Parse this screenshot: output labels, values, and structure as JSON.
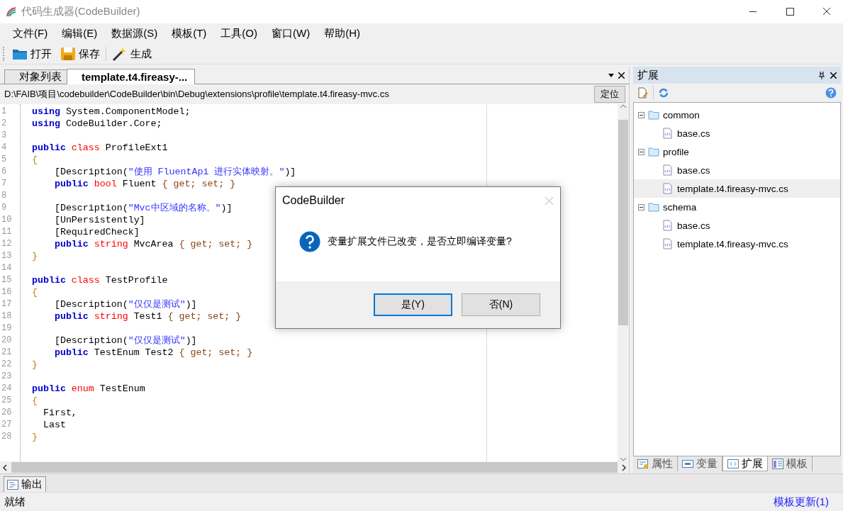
{
  "window": {
    "title": "代码生成器(CodeBuilder)"
  },
  "menu": [
    "文件(F)",
    "编辑(E)",
    "数据源(S)",
    "模板(T)",
    "工具(O)",
    "窗口(W)",
    "帮助(H)"
  ],
  "toolbar": [
    {
      "kind": "open",
      "label": "打开"
    },
    {
      "kind": "save",
      "label": "保存"
    },
    {
      "kind": "generate",
      "label": "生成"
    }
  ],
  "document_tabs": [
    {
      "label": "对象列表",
      "selected": false
    },
    {
      "label": "template.t4.fireasy-...",
      "selected": true
    }
  ],
  "path_bar": {
    "path": "D:\\FAIB\\项目\\codebuilder\\CodeBuilder\\bin\\Debug\\extensions\\profile\\template.t4.fireasy-mvc.cs",
    "button": "定位"
  },
  "code_lines": [
    {
      "n": "1",
      "segs": [
        {
          "kind": "kw",
          "text": "using"
        },
        {
          "kind": "plain",
          "text": " System.ComponentModel;"
        }
      ]
    },
    {
      "n": "2",
      "segs": [
        {
          "kind": "kw",
          "text": "using"
        },
        {
          "kind": "plain",
          "text": " CodeBuilder.Core;"
        }
      ]
    },
    {
      "n": "3"
    },
    {
      "n": "4",
      "segs": [
        {
          "kind": "kw",
          "text": "public"
        },
        {
          "kind": "type",
          "text": " class"
        },
        {
          "kind": "plain",
          "text": " ProfileExt1"
        }
      ]
    },
    {
      "n": "5",
      "segs": [
        {
          "kind": "brace",
          "text": "{"
        }
      ]
    },
    {
      "n": "6",
      "segs": [
        {
          "kind": "plain",
          "text": "    [Description("
        },
        {
          "kind": "str",
          "text": "\"使用 FluentApi 进行实体映射。\""
        },
        {
          "kind": "plain",
          "text": ")]"
        }
      ]
    },
    {
      "n": "7",
      "segs": [
        {
          "kind": "kw",
          "text": "    public"
        },
        {
          "kind": "type",
          "text": " bool"
        },
        {
          "kind": "plain",
          "text": " Fluent "
        },
        {
          "kind": "acc",
          "text": "{ get; set; }"
        }
      ]
    },
    {
      "n": "8"
    },
    {
      "n": "9",
      "segs": [
        {
          "kind": "plain",
          "text": "    [Description("
        },
        {
          "kind": "str",
          "text": "\"Mvc中区域的名称。\""
        },
        {
          "kind": "plain",
          "text": ")]"
        }
      ]
    },
    {
      "n": "10",
      "segs": [
        {
          "kind": "plain",
          "text": "    [UnPersistently]"
        }
      ]
    },
    {
      "n": "11",
      "segs": [
        {
          "kind": "plain",
          "text": "    [RequiredCheck]"
        }
      ]
    },
    {
      "n": "12",
      "segs": [
        {
          "kind": "kw",
          "text": "    public"
        },
        {
          "kind": "type",
          "text": " string"
        },
        {
          "kind": "plain",
          "text": " MvcArea "
        },
        {
          "kind": "acc",
          "text": "{ get; set; }"
        }
      ]
    },
    {
      "n": "13",
      "segs": [
        {
          "kind": "brace",
          "text": "}"
        }
      ]
    },
    {
      "n": "14"
    },
    {
      "n": "15",
      "segs": [
        {
          "kind": "kw",
          "text": "public"
        },
        {
          "kind": "type",
          "text": " class"
        },
        {
          "kind": "plain",
          "text": " TestProfile"
        }
      ]
    },
    {
      "n": "16",
      "segs": [
        {
          "kind": "brace",
          "text": "{"
        }
      ]
    },
    {
      "n": "17",
      "segs": [
        {
          "kind": "plain",
          "text": "    [Description("
        },
        {
          "kind": "str",
          "text": "\"仅仅是测试\""
        },
        {
          "kind": "plain",
          "text": ")]"
        }
      ]
    },
    {
      "n": "18",
      "segs": [
        {
          "kind": "kw",
          "text": "    public"
        },
        {
          "kind": "type",
          "text": " string"
        },
        {
          "kind": "plain",
          "text": " Test1 "
        },
        {
          "kind": "acc",
          "text": "{ get; set; }"
        }
      ]
    },
    {
      "n": "19"
    },
    {
      "n": "20",
      "segs": [
        {
          "kind": "plain",
          "text": "    [Description("
        },
        {
          "kind": "str",
          "text": "\"仅仅是测试\""
        },
        {
          "kind": "plain",
          "text": ")]"
        }
      ]
    },
    {
      "n": "21",
      "segs": [
        {
          "kind": "kw",
          "text": "    public"
        },
        {
          "kind": "plain",
          "text": " TestEnum Test2 "
        },
        {
          "kind": "acc",
          "text": "{ get; set; }"
        }
      ]
    },
    {
      "n": "22",
      "segs": [
        {
          "kind": "brace",
          "text": "}"
        }
      ]
    },
    {
      "n": "23"
    },
    {
      "n": "24",
      "segs": [
        {
          "kind": "kw",
          "text": "public"
        },
        {
          "kind": "type",
          "text": " enum"
        },
        {
          "kind": "plain",
          "text": " TestEnum"
        }
      ]
    },
    {
      "n": "25",
      "segs": [
        {
          "kind": "brace",
          "text": "{"
        }
      ]
    },
    {
      "n": "26",
      "segs": [
        {
          "kind": "plain",
          "text": "  First,"
        }
      ]
    },
    {
      "n": "27",
      "segs": [
        {
          "kind": "plain",
          "text": "  Last"
        }
      ]
    },
    {
      "n": "28",
      "segs": [
        {
          "kind": "brace",
          "text": "}"
        }
      ]
    }
  ],
  "side_panel": {
    "title": "扩展",
    "tree": [
      {
        "label": "common",
        "kind": "folder",
        "expanded": true,
        "selected": false,
        "children": [
          {
            "label": "base.cs",
            "kind": "file",
            "selected": false
          }
        ]
      },
      {
        "label": "profile",
        "kind": "folder",
        "expanded": true,
        "selected": false,
        "children": [
          {
            "label": "base.cs",
            "kind": "file",
            "selected": false
          },
          {
            "label": "template.t4.fireasy-mvc.cs",
            "kind": "file",
            "selected": true
          }
        ]
      },
      {
        "label": "schema",
        "kind": "folder",
        "expanded": true,
        "selected": false,
        "children": [
          {
            "label": "base.cs",
            "kind": "file",
            "selected": false
          },
          {
            "label": "template.t4.fireasy-mvc.cs",
            "kind": "file",
            "selected": false
          }
        ]
      }
    ],
    "tabs": [
      {
        "label": "属性",
        "kind": "properties",
        "selected": false
      },
      {
        "label": "变量",
        "kind": "variables",
        "selected": false
      },
      {
        "label": "扩展",
        "kind": "extensions",
        "selected": true
      },
      {
        "label": "模板",
        "kind": "templates",
        "selected": false
      }
    ]
  },
  "output_tab": {
    "label": "输出"
  },
  "status_bar": {
    "text": "就绪",
    "link": "模板更新(1)"
  },
  "dialog": {
    "title": "CodeBuilder",
    "message": "变量扩展文件已改变，是否立即编译变量?",
    "buttons": [
      {
        "label": "是(Y)",
        "focused": true
      },
      {
        "label": "否(N)",
        "focused": false
      }
    ]
  }
}
